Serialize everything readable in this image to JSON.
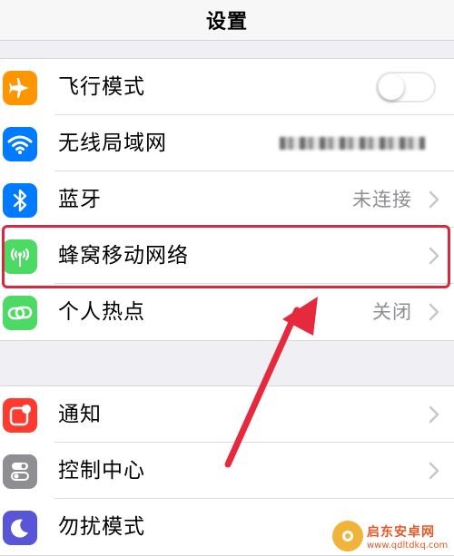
{
  "nav": {
    "title": "设置"
  },
  "group1": [
    {
      "label": "飞行模式",
      "icon": "airplane-icon",
      "color": "#ff9500",
      "control": "toggle",
      "toggle_on": false
    },
    {
      "label": "无线局域网",
      "icon": "wifi-icon",
      "color": "#007aff",
      "control": "blurred-value",
      "value": ""
    },
    {
      "label": "蓝牙",
      "icon": "bluetooth-icon",
      "color": "#007aff",
      "control": "value",
      "value": "未连接"
    },
    {
      "label": "蜂窝移动网络",
      "icon": "cellular-antenna-icon",
      "color": "#4cd964",
      "control": "chevron",
      "value": ""
    },
    {
      "label": "个人热点",
      "icon": "hotspot-link-icon",
      "color": "#4cd964",
      "control": "value",
      "value": "关闭"
    }
  ],
  "group2": [
    {
      "label": "通知",
      "icon": "notifications-icon",
      "color": "#ff3b30",
      "control": "chevron"
    },
    {
      "label": "控制中心",
      "icon": "control-center-icon",
      "color": "#8e8e93",
      "control": "chevron"
    },
    {
      "label": "勿扰模式",
      "icon": "moon-icon",
      "color": "#5856d6",
      "control": "chevron"
    }
  ],
  "annotation": {
    "highlight_color": "#d8283f",
    "highlight_target": "蜂窝移动网络"
  },
  "watermark": {
    "name": "启东安卓网",
    "url": "www.qdltdkq.com"
  }
}
